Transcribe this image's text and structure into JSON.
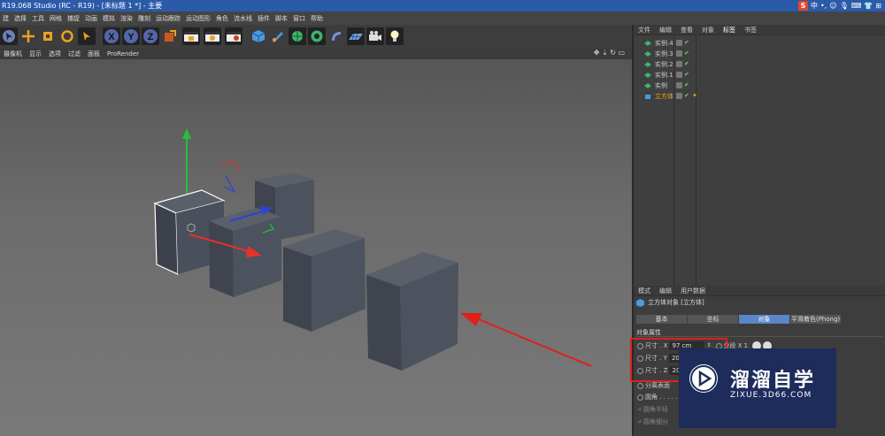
{
  "window": {
    "title": "R19.068 Studio (RC - R19) - [未标题 1 *] - 主要",
    "ime": [
      "S",
      "中",
      "•,",
      "☺",
      "🎙",
      "⌨",
      "👕",
      "⊞"
    ]
  },
  "menubar": [
    "建",
    "选择",
    "工具",
    "网格",
    "捕捉",
    "动画",
    "模拟",
    "渲染",
    "雕刻",
    "运动跟踪",
    "运动图形",
    "角色",
    "流水线",
    "插件",
    "脚本",
    "窗口",
    "帮助"
  ],
  "toolbar": {
    "axis_x": "X",
    "axis_y": "Y",
    "axis_z": "Z"
  },
  "viewport_menu": [
    "摄像机",
    "显示",
    "选项",
    "过滤",
    "面板",
    "ProRender"
  ],
  "viewport_nav": "✥ ⇣ ↻ ▭",
  "object_manager": {
    "tabs": [
      "文件",
      "编辑",
      "查看",
      "对象",
      "标签",
      "书签"
    ],
    "active_tab": "标签",
    "objects": [
      {
        "name": "实例.4",
        "selected": false
      },
      {
        "name": "实例.3",
        "selected": false
      },
      {
        "name": "实例.2",
        "selected": false
      },
      {
        "name": "实例.1",
        "selected": false
      },
      {
        "name": "实例",
        "selected": false
      },
      {
        "name": "立方体",
        "selected": true
      }
    ]
  },
  "attribute_manager": {
    "menu": [
      "模式",
      "编辑",
      "用户数据"
    ],
    "title": "立方体对象 [立方体]",
    "tabs": [
      "基本",
      "坐标",
      "对象",
      "平滑着色(Phong)"
    ],
    "active_tab": "对象",
    "section": "对象属性",
    "props": [
      {
        "label": "尺寸 . X",
        "value": "97 cm"
      },
      {
        "label": "尺寸 . Y",
        "value": "20"
      },
      {
        "label": "尺寸 . Z",
        "value": "20"
      }
    ],
    "segments_label": "分段 X",
    "segments_value": "1",
    "separate_faces": "分离表面",
    "fillet": "圆角 . . . . .",
    "fillet_radius": "圆角半径",
    "fillet_subdiv": "圆角细分"
  },
  "watermark": {
    "brand": "溜溜自学",
    "url": "ZIXUE.3D66.COM"
  },
  "colors": {
    "title_bg": "#2b5aa8",
    "accent_blue": "#5b85c7",
    "selected_orange": "#f5a623",
    "annotation_red": "#e0201a",
    "axis_x": "#e8302a",
    "axis_y": "#21c23a",
    "axis_z": "#2c43d6"
  }
}
